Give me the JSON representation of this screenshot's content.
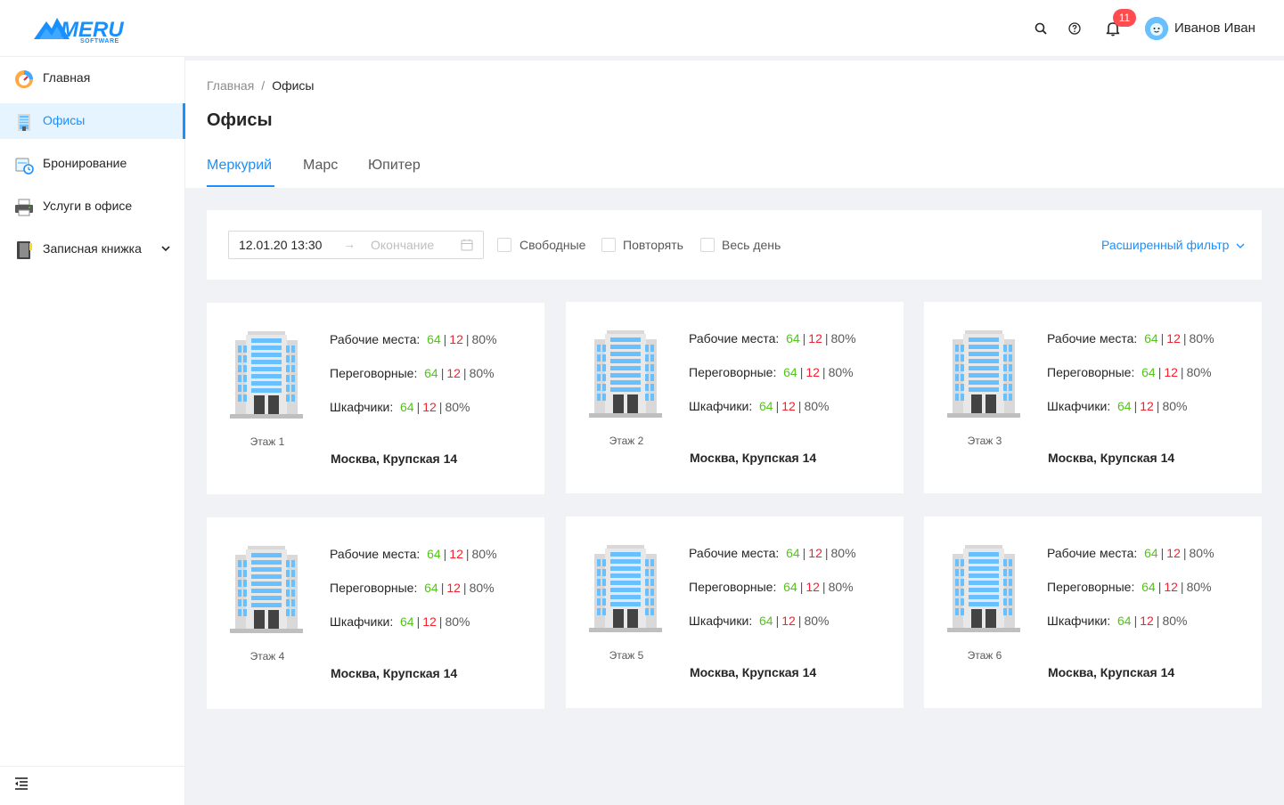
{
  "header": {
    "logo_text": "MERU",
    "logo_subtext": "SOFTWARE",
    "notifications_count": "11",
    "user_name": "Иванов Иван",
    "icons": [
      "search-icon",
      "help-icon",
      "bell-icon",
      "avatar"
    ]
  },
  "sidebar": {
    "items": [
      {
        "label": "Главная",
        "icon": "speedometer-icon"
      },
      {
        "label": "Офисы",
        "icon": "office-building-icon"
      },
      {
        "label": "Бронирование",
        "icon": "booking-clock-icon"
      },
      {
        "label": "Услуги в офисе",
        "icon": "printer-icon"
      },
      {
        "label": "Записная книжка",
        "icon": "notebook-icon"
      }
    ],
    "active_item": "Офисы"
  },
  "breadcrumb": {
    "home": "Главная",
    "separator": "/",
    "current": "Офисы"
  },
  "page_title": "Офисы",
  "tabs": [
    {
      "label": "Меркурий",
      "active": true
    },
    {
      "label": "Марс",
      "active": false
    },
    {
      "label": "Юпитер",
      "active": false
    }
  ],
  "filter": {
    "start_value": "12.01.20 13:30",
    "arrow": "→",
    "end_placeholder": "Окончание",
    "checkboxes": [
      {
        "label": "Свободные",
        "checked": false
      },
      {
        "label": "Повторять",
        "checked": false
      },
      {
        "label": "Весь день",
        "checked": false
      }
    ],
    "advanced_label": "Расширенный фильтр"
  },
  "stat_labels": {
    "workplaces": "Рабочие места",
    "meeting_rooms": "Переговорные",
    "lockers": "Шкафчики"
  },
  "cards": [
    {
      "floor": "Этаж 1",
      "address": "Москва, Крупская 14",
      "stats": {
        "free": "64",
        "busy": "12",
        "percent": "80%"
      }
    },
    {
      "floor": "Этаж 2",
      "address": "Москва, Крупская 14",
      "stats": {
        "free": "64",
        "busy": "12",
        "percent": "80%"
      }
    },
    {
      "floor": "Этаж 3",
      "address": "Москва, Крупская 14",
      "stats": {
        "free": "64",
        "busy": "12",
        "percent": "80%"
      }
    },
    {
      "floor": "Этаж 4",
      "address": "Москва, Крупская 14",
      "stats": {
        "free": "64",
        "busy": "12",
        "percent": "80%"
      }
    },
    {
      "floor": "Этаж 5",
      "address": "Москва, Крупская 14",
      "stats": {
        "free": "64",
        "busy": "12",
        "percent": "80%"
      }
    },
    {
      "floor": "Этаж 6",
      "address": "Москва, Крупская 14",
      "stats": {
        "free": "64",
        "busy": "12",
        "percent": "80%"
      }
    }
  ],
  "colors": {
    "accent": "#1890ff",
    "free": "#52c41a",
    "busy": "#f5222d",
    "badge": "#ff4d4f"
  }
}
